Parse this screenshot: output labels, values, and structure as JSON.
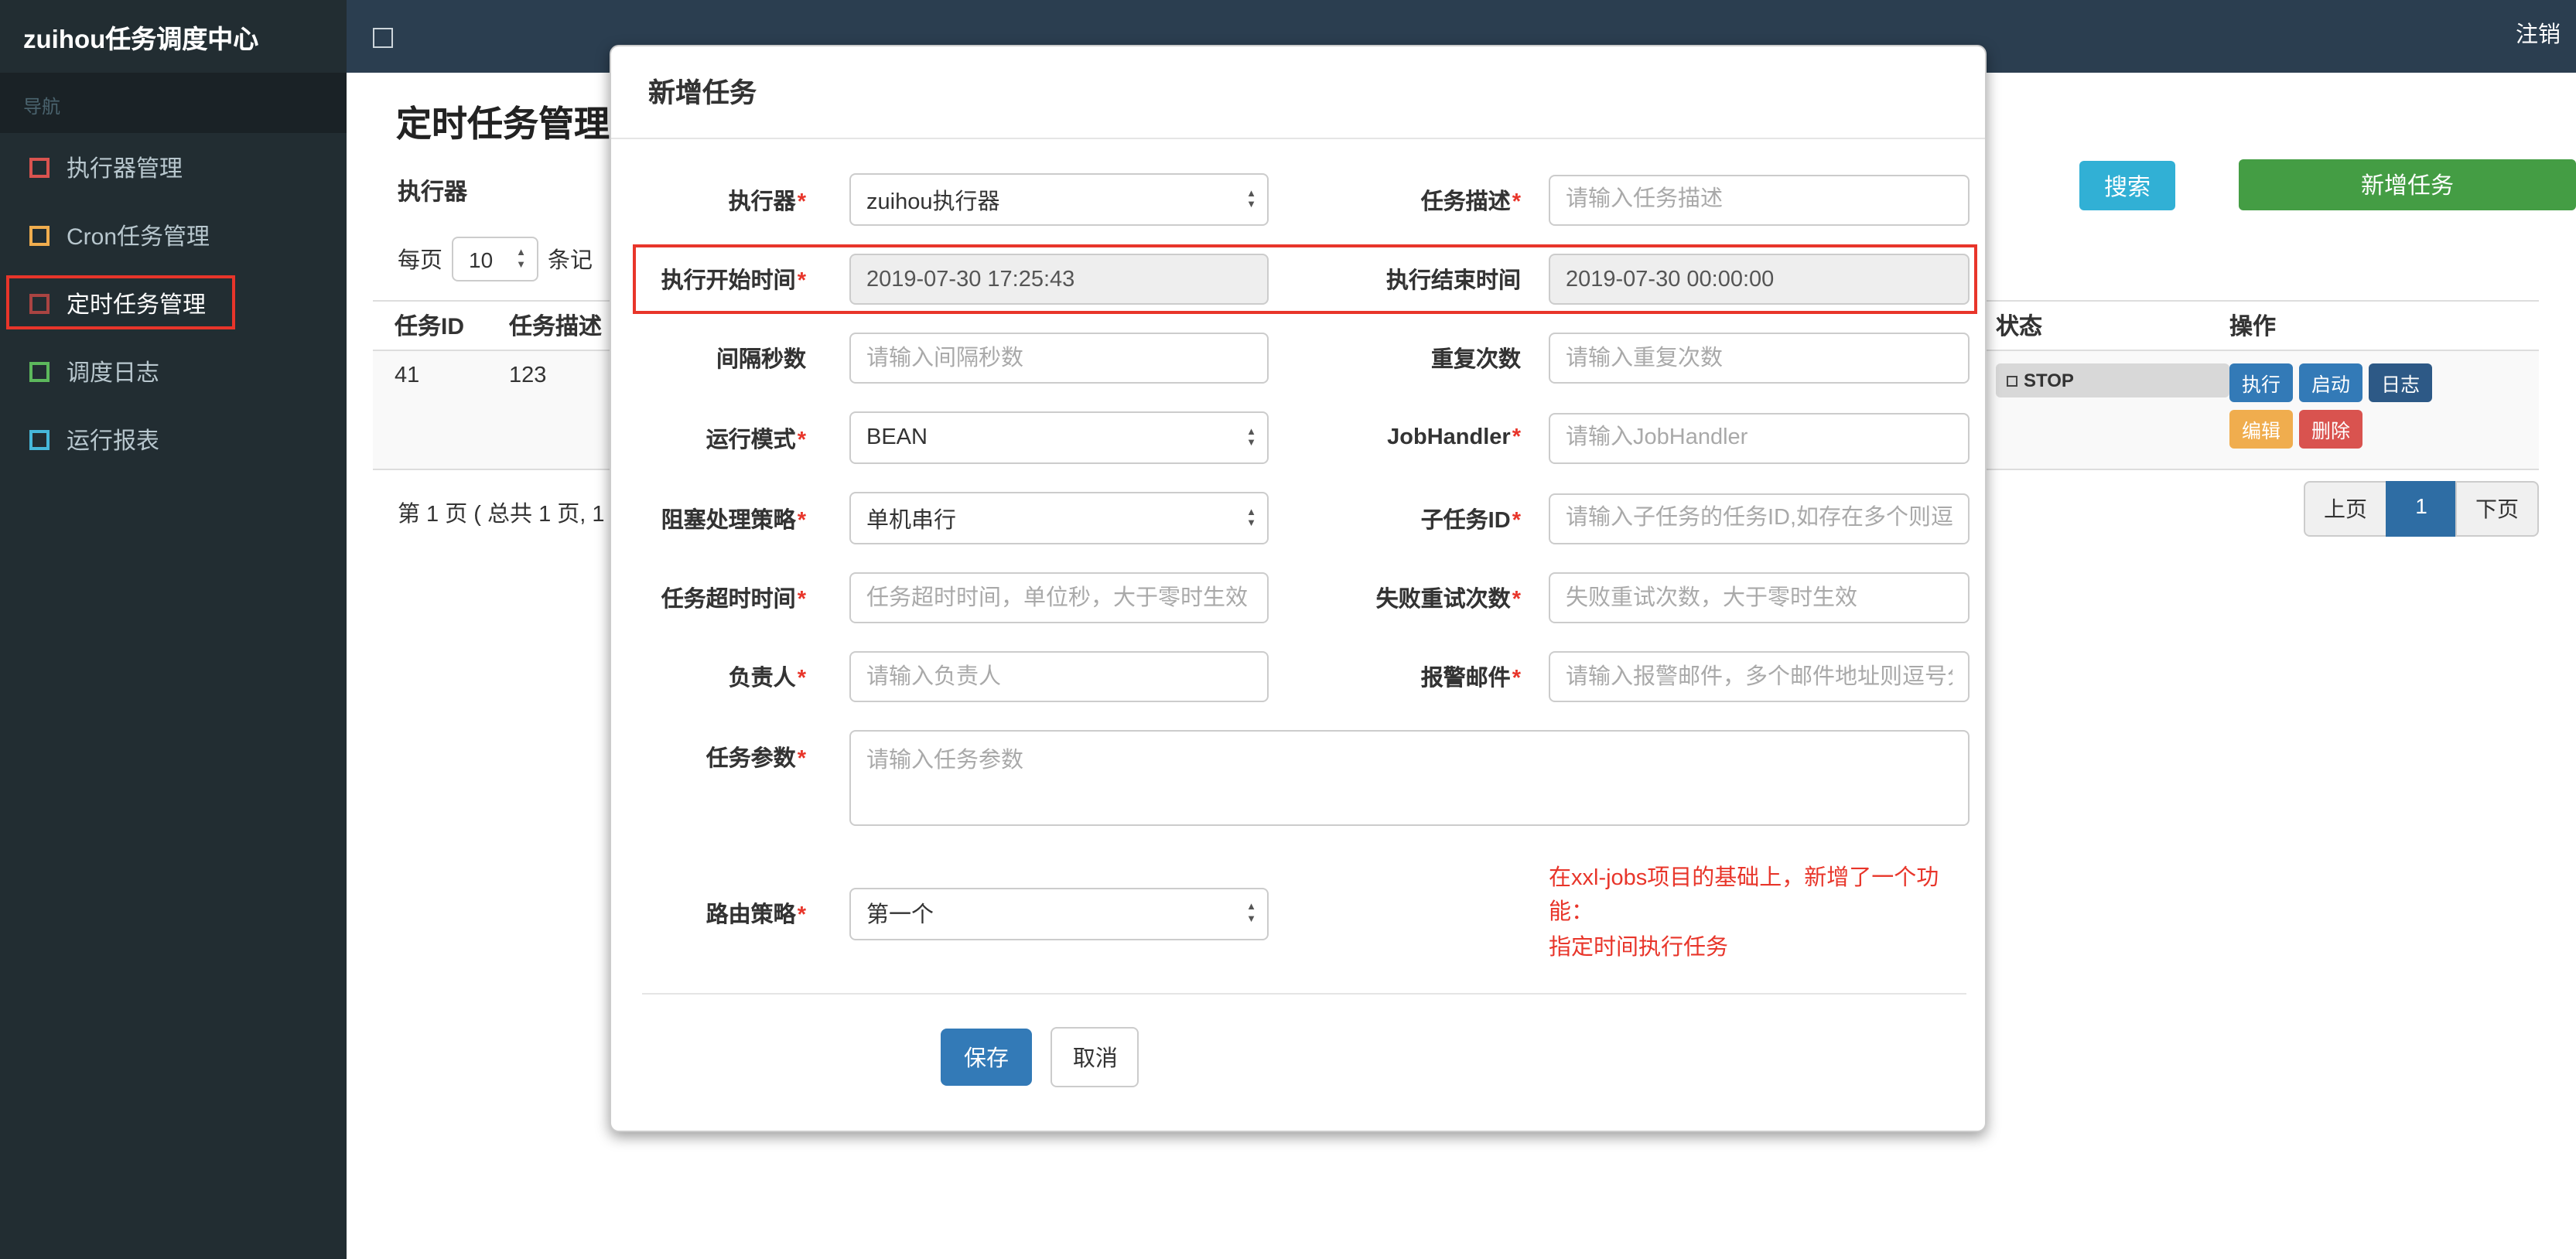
{
  "topbar": {
    "brand": "zuihou任务调度中心",
    "logout": "注销"
  },
  "sidebar": {
    "header": "导航",
    "items": [
      {
        "label": "执行器管理",
        "icon_style": "border-color:#d9534f"
      },
      {
        "label": "Cron任务管理",
        "icon_style": "border-color:#f0ad4e"
      },
      {
        "label": "定时任务管理",
        "icon_style": "border-color:#a94442"
      },
      {
        "label": "调度日志",
        "icon_style": "border-color:#5cb85c"
      },
      {
        "label": "运行报表",
        "icon_style": "border-color:#46b8da"
      }
    ]
  },
  "toolbar": {
    "executor_label": "执行器",
    "search": "搜索",
    "add_task": "新增任务"
  },
  "page": {
    "title": "定时任务管理",
    "per_page_prefix": "每页",
    "per_page_value": "10",
    "per_page_suffix": "条记"
  },
  "table": {
    "headers": {
      "id": "任务ID",
      "desc": "任务描述",
      "status": "状态",
      "actions": "操作"
    },
    "row": {
      "id": "41",
      "desc": "123",
      "status": "STOP",
      "btn_run": "执行",
      "btn_start": "启动",
      "btn_log": "日志",
      "btn_edit": "编辑",
      "btn_delete": "删除"
    },
    "summary": "第 1 页 ( 总共 1 页, 1",
    "pagination": {
      "prev": "上页",
      "current": "1",
      "next": "下页"
    }
  },
  "modal": {
    "title": "新增任务",
    "required_mark": "*",
    "rows": {
      "executor": {
        "label": "执行器",
        "value": "zuihou执行器"
      },
      "desc": {
        "label": "任务描述",
        "placeholder": "请输入任务描述"
      },
      "start_time": {
        "label": "执行开始时间",
        "value": "2019-07-30 17:25:43"
      },
      "end_time": {
        "label": "执行结束时间",
        "value": "2019-07-30 00:00:00"
      },
      "interval": {
        "label": "间隔秒数",
        "placeholder": "请输入间隔秒数"
      },
      "repeat": {
        "label": "重复次数",
        "placeholder": "请输入重复次数"
      },
      "run_mode": {
        "label": "运行模式",
        "value": "BEAN"
      },
      "job_handler": {
        "label": "JobHandler",
        "placeholder": "请输入JobHandler"
      },
      "block_strategy": {
        "label": "阻塞处理策略",
        "value": "单机串行"
      },
      "child_job": {
        "label": "子任务ID",
        "placeholder": "请输入子任务的任务ID,如存在多个则逗"
      },
      "timeout": {
        "label": "任务超时时间",
        "placeholder": "任务超时时间，单位秒，大于零时生效"
      },
      "retry": {
        "label": "失败重试次数",
        "placeholder": "失败重试次数，大于零时生效"
      },
      "owner": {
        "label": "负责人",
        "placeholder": "请输入负责人"
      },
      "alarm_email": {
        "label": "报警邮件",
        "placeholder": "请输入报警邮件，多个邮件地址则逗号分"
      },
      "params": {
        "label": "任务参数",
        "placeholder": "请输入任务参数"
      },
      "route_strategy": {
        "label": "路由策略",
        "value": "第一个"
      }
    },
    "note_line1": "在xxl-jobs项目的基础上，新增了一个功能：",
    "note_line2": "指定时间执行任务",
    "save": "保存",
    "cancel": "取消"
  },
  "colors": {
    "topbar": "#2b3e50",
    "sidebar": "#222d32",
    "primary": "#337ab7",
    "success": "#449d44",
    "info": "#31b0d5",
    "warning": "#f0ad4e",
    "danger": "#d9534f",
    "annotation": "#e8352a"
  }
}
